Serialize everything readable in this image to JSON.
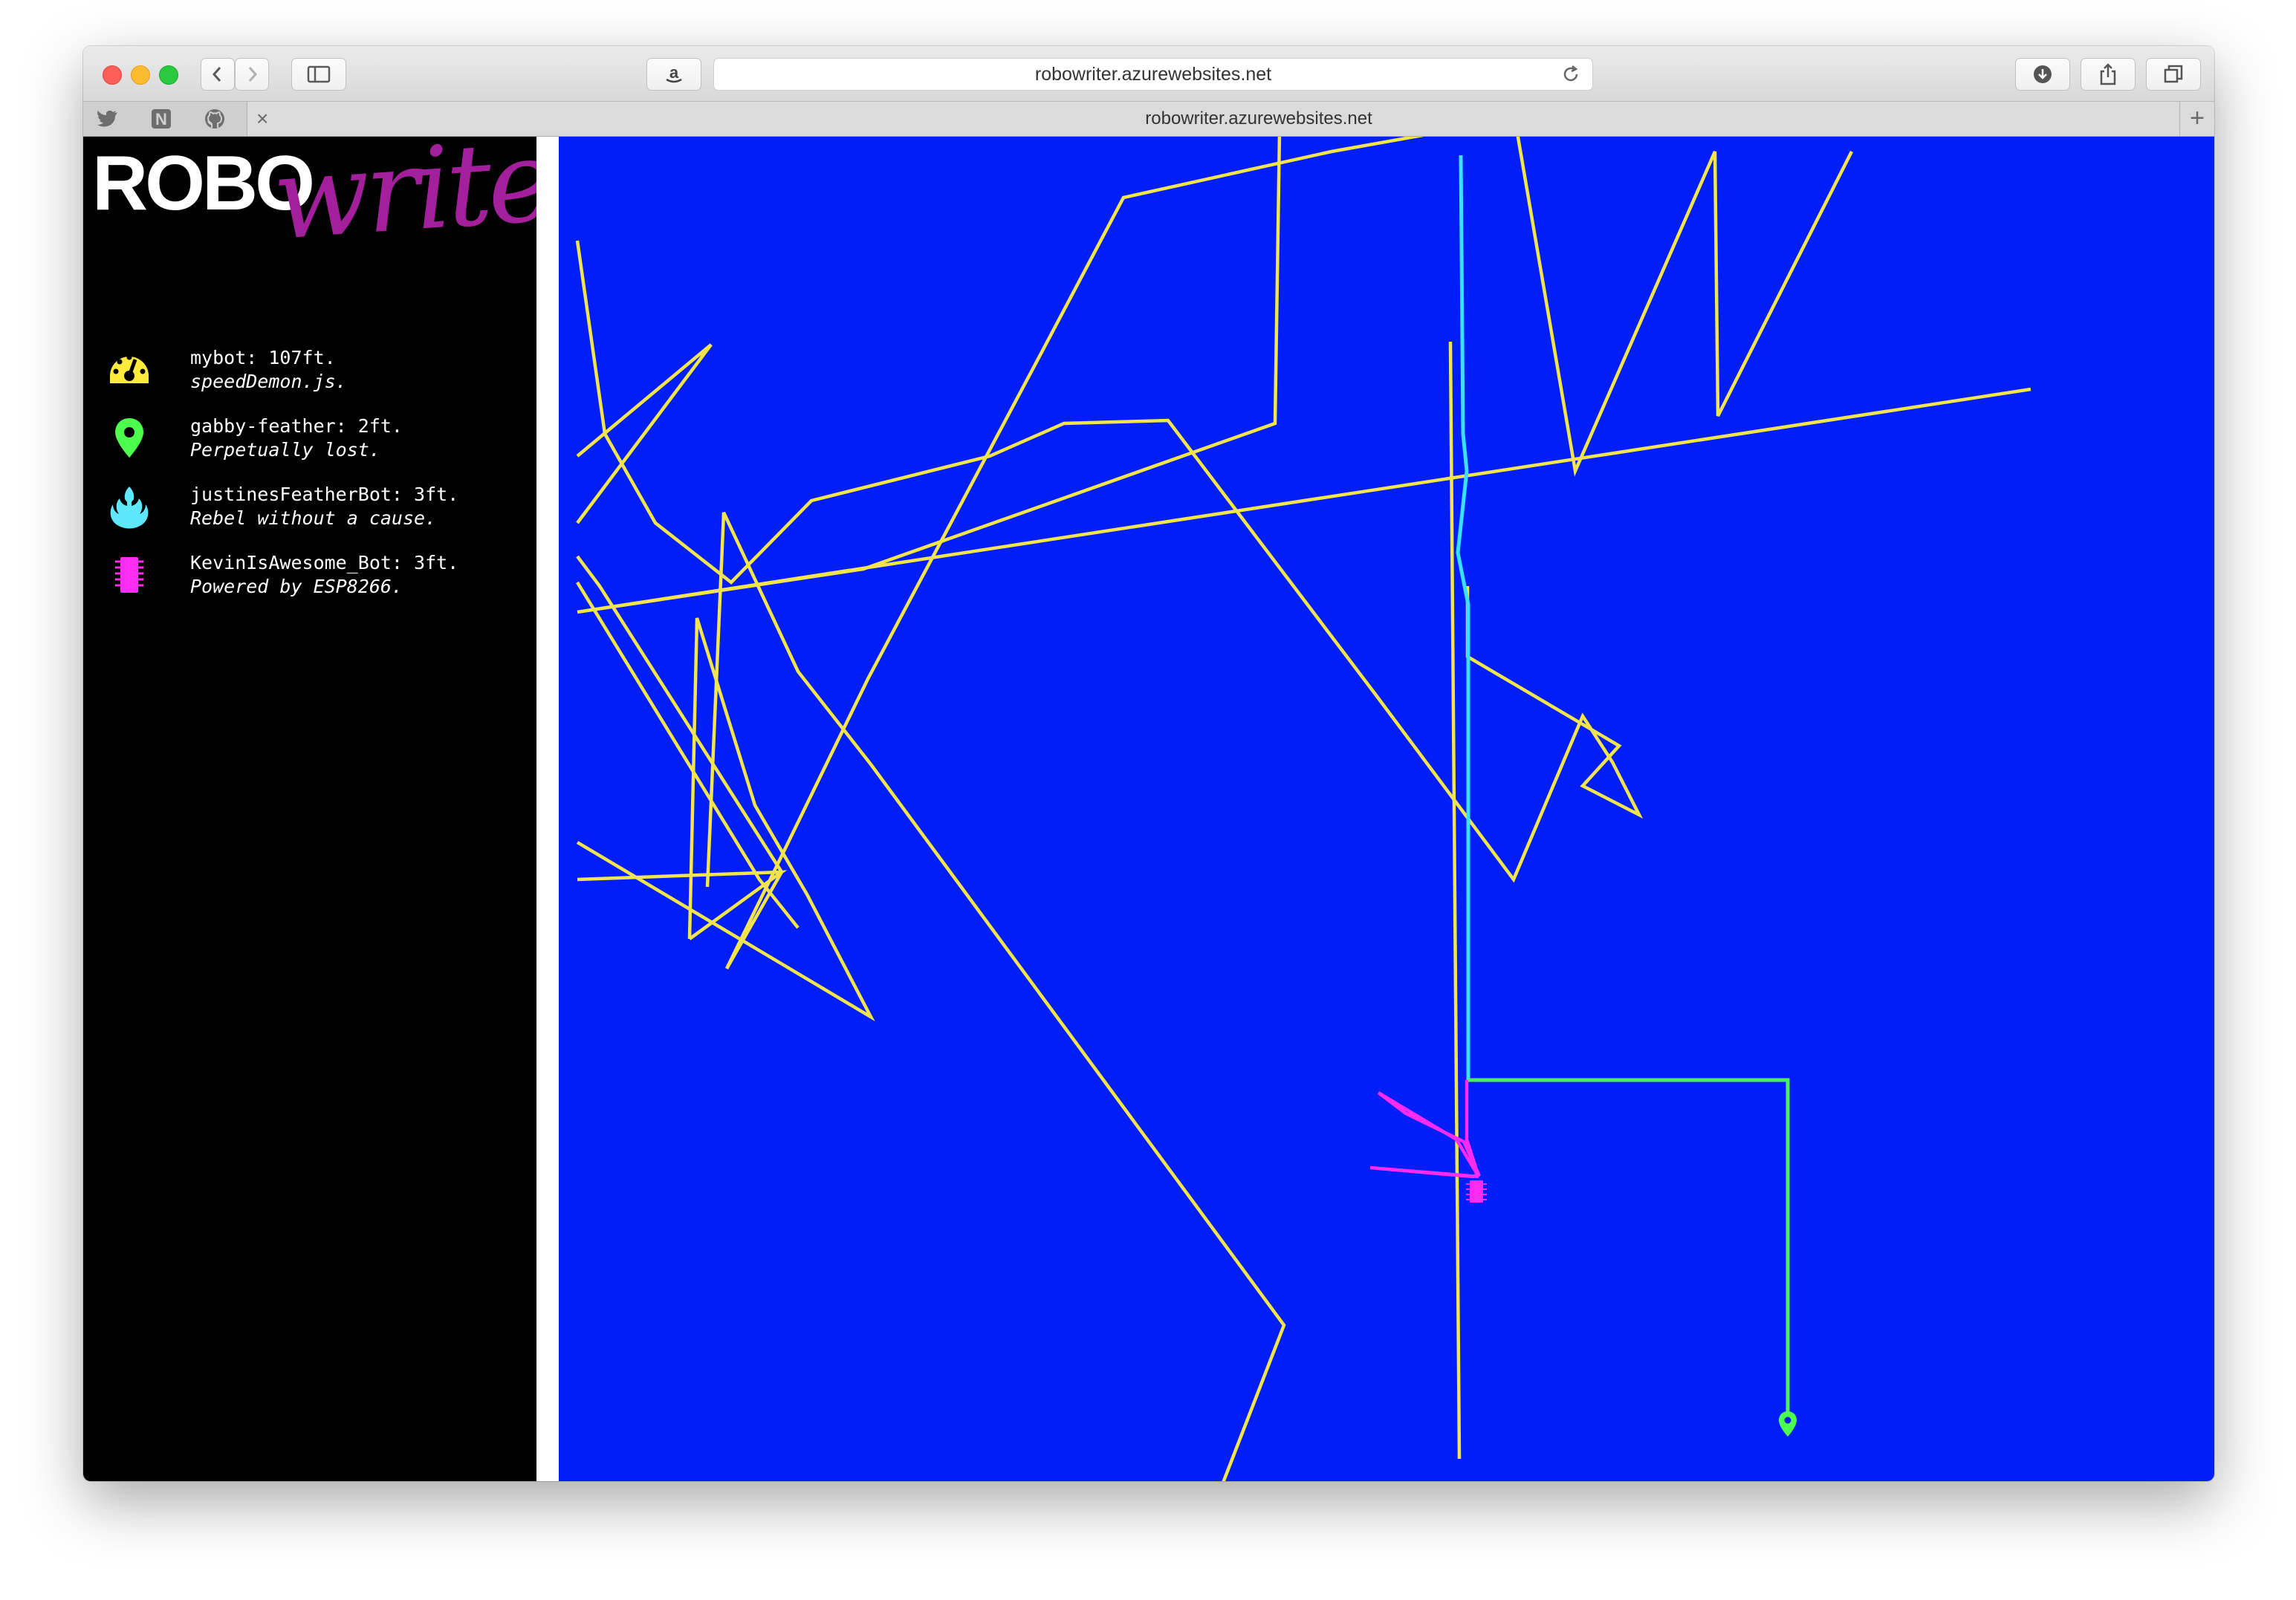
{
  "browser": {
    "url": "robowriter.azurewebsites.net",
    "tab_title": "robowriter.azurewebsites.net",
    "favorites": [
      "twitter-icon",
      "notion-icon",
      "github-icon"
    ]
  },
  "logo": {
    "robo": "ROBO",
    "writer": "writer"
  },
  "bots": [
    {
      "name": "mybot: 107ft.",
      "tagline": "speedDemon.js.",
      "icon": "speedometer-icon",
      "color": "#ffeb3b"
    },
    {
      "name": "gabby-feather: 2ft.",
      "tagline": "Perpetually lost.",
      "icon": "map-pin-icon",
      "color": "#4cff4c"
    },
    {
      "name": "justinesFeatherBot: 3ft.",
      "tagline": "Rebel without a cause.",
      "icon": "rebel-alliance-icon",
      "color": "#5ee8ff"
    },
    {
      "name": "KevinIsAwesome_Bot: 3ft.",
      "tagline": "Powered by ESP8266.",
      "icon": "microchip-icon",
      "color": "#ff2bf0"
    }
  ],
  "canvas": {
    "background": "#001ef5"
  }
}
